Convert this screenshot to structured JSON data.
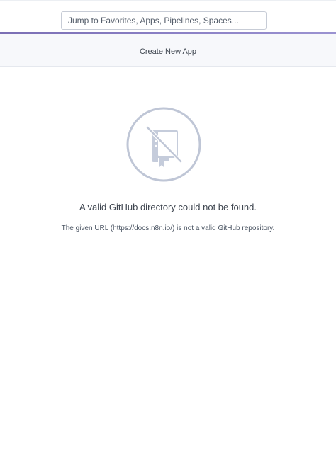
{
  "header": {
    "search_placeholder": "Jump to Favorites, Apps, Pipelines, Spaces..."
  },
  "subheader": {
    "title": "Create New App"
  },
  "empty_state": {
    "icon": "no-repository-icon",
    "title": "A valid GitHub directory could not be found.",
    "description": "The given URL (https://docs.n8n.io/) is not a valid GitHub repository."
  },
  "colors": {
    "accent": "#8a80c5",
    "icon": "#bfc6d6",
    "text": "#3f4650"
  }
}
